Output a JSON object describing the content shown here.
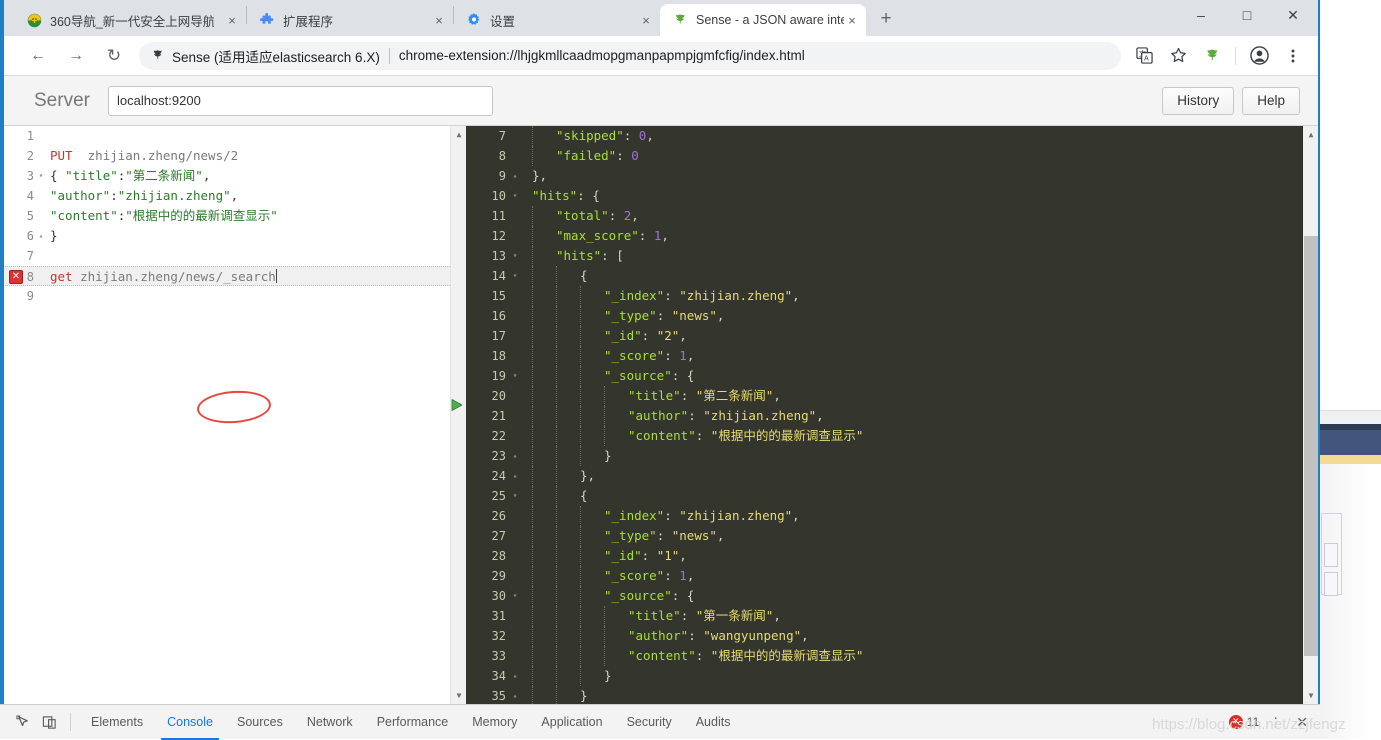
{
  "browser": {
    "tabs": [
      {
        "title": "360导航_新一代安全上网导航",
        "favicon": "shield-360-icon",
        "active": false,
        "close_label": "×"
      },
      {
        "title": "扩展程序",
        "favicon": "puzzle-icon",
        "active": false,
        "close_label": "×"
      },
      {
        "title": "设置",
        "favicon": "gear-icon",
        "active": false,
        "close_label": "×"
      },
      {
        "title": "Sense - a JSON aware interface",
        "favicon": "sense-leaf-icon",
        "active": true,
        "close_label": "×"
      }
    ],
    "new_tab_label": "+",
    "window_controls": {
      "minimize": "–",
      "maximize": "□",
      "close": "✕"
    },
    "nav": {
      "back": "←",
      "forward": "→",
      "reload": "↻",
      "omnibox_extension_name": "Sense (适用适应elasticsearch 6.X)",
      "omnibox_url": "chrome-extension://lhjgkmllcaadmopgmanpapmpjgmfcfig/index.html",
      "translate_icon": "translate-icon",
      "bookmark_icon": "star-icon",
      "extension_icon": "sense-leaf-icon",
      "profile_icon": "profile-avatar-icon",
      "menu_icon": "kebab-menu-icon"
    }
  },
  "sense": {
    "server_label": "Server",
    "server_value": "localhost:9200",
    "server_placeholder": "localhost:9200",
    "history_label": "History",
    "help_label": "Help"
  },
  "request_editor": {
    "error_marker_line": 8,
    "error_marker_glyph": "✕",
    "play_icon": "run-request-icon",
    "wrench_icon": "settings-wrench-icon",
    "annotation": "red-ellipse-highlight",
    "lines": [
      {
        "n": "1",
        "fold": "",
        "tokens": []
      },
      {
        "n": "2",
        "fold": "",
        "tokens": [
          {
            "c": "tk-method",
            "t": "PUT"
          },
          {
            "c": "tk-plain",
            "t": "  "
          },
          {
            "c": "tk-url",
            "t": "zhijian.zheng/news/2"
          }
        ]
      },
      {
        "n": "3",
        "fold": "▾",
        "tokens": [
          {
            "c": "tk-punc",
            "t": "{ "
          },
          {
            "c": "tk-key",
            "t": "\"title\""
          },
          {
            "c": "tk-punc",
            "t": ":"
          },
          {
            "c": "tk-str",
            "t": "\"第二条新闻\""
          },
          {
            "c": "tk-punc",
            "t": ","
          }
        ]
      },
      {
        "n": "4",
        "fold": "",
        "tokens": [
          {
            "c": "tk-key",
            "t": "\"author\""
          },
          {
            "c": "tk-punc",
            "t": ":"
          },
          {
            "c": "tk-str",
            "t": "\"zhijian.zheng\""
          },
          {
            "c": "tk-punc",
            "t": ","
          }
        ]
      },
      {
        "n": "5",
        "fold": "",
        "tokens": [
          {
            "c": "tk-key",
            "t": "\"content\""
          },
          {
            "c": "tk-punc",
            "t": ":"
          },
          {
            "c": "tk-str",
            "t": "\"根据中的的最新调查显示\""
          }
        ]
      },
      {
        "n": "6",
        "fold": "▴",
        "tokens": [
          {
            "c": "tk-punc",
            "t": "}"
          }
        ]
      },
      {
        "n": "7",
        "fold": "",
        "tokens": []
      },
      {
        "n": "8",
        "fold": "",
        "active": true,
        "tokens": [
          {
            "c": "tk-method",
            "t": "get"
          },
          {
            "c": "tk-plain",
            "t": " "
          },
          {
            "c": "tk-url",
            "t": "zhijian.zheng/news/_search"
          }
        ]
      },
      {
        "n": "9",
        "fold": "",
        "tokens": []
      }
    ]
  },
  "response_viewer": {
    "lines": [
      {
        "n": "7",
        "fold": "",
        "ind": 2,
        "tokens": [
          {
            "c": "rk",
            "t": "\"skipped\""
          },
          {
            "c": "rp",
            "t": ": "
          },
          {
            "c": "rn",
            "t": "0"
          },
          {
            "c": "rp",
            "t": ","
          }
        ]
      },
      {
        "n": "8",
        "fold": "",
        "ind": 2,
        "tokens": [
          {
            "c": "rk",
            "t": "\"failed\""
          },
          {
            "c": "rp",
            "t": ": "
          },
          {
            "c": "rn",
            "t": "0"
          }
        ]
      },
      {
        "n": "9",
        "fold": "▴",
        "ind": 1,
        "tokens": [
          {
            "c": "rp",
            "t": "},"
          }
        ]
      },
      {
        "n": "10",
        "fold": "▾",
        "ind": 1,
        "tokens": [
          {
            "c": "rk",
            "t": "\"hits\""
          },
          {
            "c": "rp",
            "t": ": {"
          }
        ]
      },
      {
        "n": "11",
        "fold": "",
        "ind": 2,
        "tokens": [
          {
            "c": "rk",
            "t": "\"total\""
          },
          {
            "c": "rp",
            "t": ": "
          },
          {
            "c": "rn",
            "t": "2"
          },
          {
            "c": "rp",
            "t": ","
          }
        ]
      },
      {
        "n": "12",
        "fold": "",
        "ind": 2,
        "tokens": [
          {
            "c": "rk",
            "t": "\"max_score\""
          },
          {
            "c": "rp",
            "t": ": "
          },
          {
            "c": "rn",
            "t": "1"
          },
          {
            "c": "rp",
            "t": ","
          }
        ]
      },
      {
        "n": "13",
        "fold": "▾",
        "ind": 2,
        "tokens": [
          {
            "c": "rk",
            "t": "\"hits\""
          },
          {
            "c": "rp",
            "t": ": ["
          }
        ]
      },
      {
        "n": "14",
        "fold": "▾",
        "ind": 3,
        "tokens": [
          {
            "c": "rp",
            "t": "{"
          }
        ]
      },
      {
        "n": "15",
        "fold": "",
        "ind": 4,
        "tokens": [
          {
            "c": "rk",
            "t": "\"_index\""
          },
          {
            "c": "rp",
            "t": ": "
          },
          {
            "c": "rs",
            "t": "\"zhijian.zheng\""
          },
          {
            "c": "rp",
            "t": ","
          }
        ]
      },
      {
        "n": "16",
        "fold": "",
        "ind": 4,
        "tokens": [
          {
            "c": "rk",
            "t": "\"_type\""
          },
          {
            "c": "rp",
            "t": ": "
          },
          {
            "c": "rs",
            "t": "\"news\""
          },
          {
            "c": "rp",
            "t": ","
          }
        ]
      },
      {
        "n": "17",
        "fold": "",
        "ind": 4,
        "tokens": [
          {
            "c": "rk",
            "t": "\"_id\""
          },
          {
            "c": "rp",
            "t": ": "
          },
          {
            "c": "rs",
            "t": "\"2\""
          },
          {
            "c": "rp",
            "t": ","
          }
        ]
      },
      {
        "n": "18",
        "fold": "",
        "ind": 4,
        "tokens": [
          {
            "c": "rk",
            "t": "\"_score\""
          },
          {
            "c": "rp",
            "t": ": "
          },
          {
            "c": "rn",
            "t": "1"
          },
          {
            "c": "rp",
            "t": ","
          }
        ]
      },
      {
        "n": "19",
        "fold": "▾",
        "ind": 4,
        "tokens": [
          {
            "c": "rk",
            "t": "\"_source\""
          },
          {
            "c": "rp",
            "t": ": {"
          }
        ]
      },
      {
        "n": "20",
        "fold": "",
        "ind": 5,
        "tokens": [
          {
            "c": "rk",
            "t": "\"title\""
          },
          {
            "c": "rp",
            "t": ": "
          },
          {
            "c": "rs",
            "t": "\"第二条新闻\""
          },
          {
            "c": "rp",
            "t": ","
          }
        ]
      },
      {
        "n": "21",
        "fold": "",
        "ind": 5,
        "tokens": [
          {
            "c": "rk",
            "t": "\"author\""
          },
          {
            "c": "rp",
            "t": ": "
          },
          {
            "c": "rs",
            "t": "\"zhijian.zheng\""
          },
          {
            "c": "rp",
            "t": ","
          }
        ]
      },
      {
        "n": "22",
        "fold": "",
        "ind": 5,
        "tokens": [
          {
            "c": "rk",
            "t": "\"content\""
          },
          {
            "c": "rp",
            "t": ": "
          },
          {
            "c": "rs",
            "t": "\"根据中的的最新调查显示\""
          }
        ]
      },
      {
        "n": "23",
        "fold": "▴",
        "ind": 4,
        "tokens": [
          {
            "c": "rp",
            "t": "}"
          }
        ]
      },
      {
        "n": "24",
        "fold": "▴",
        "ind": 3,
        "tokens": [
          {
            "c": "rp",
            "t": "},"
          }
        ]
      },
      {
        "n": "25",
        "fold": "▾",
        "ind": 3,
        "tokens": [
          {
            "c": "rp",
            "t": "{"
          }
        ]
      },
      {
        "n": "26",
        "fold": "",
        "ind": 4,
        "tokens": [
          {
            "c": "rk",
            "t": "\"_index\""
          },
          {
            "c": "rp",
            "t": ": "
          },
          {
            "c": "rs",
            "t": "\"zhijian.zheng\""
          },
          {
            "c": "rp",
            "t": ","
          }
        ]
      },
      {
        "n": "27",
        "fold": "",
        "ind": 4,
        "tokens": [
          {
            "c": "rk",
            "t": "\"_type\""
          },
          {
            "c": "rp",
            "t": ": "
          },
          {
            "c": "rs",
            "t": "\"news\""
          },
          {
            "c": "rp",
            "t": ","
          }
        ]
      },
      {
        "n": "28",
        "fold": "",
        "ind": 4,
        "tokens": [
          {
            "c": "rk",
            "t": "\"_id\""
          },
          {
            "c": "rp",
            "t": ": "
          },
          {
            "c": "rs",
            "t": "\"1\""
          },
          {
            "c": "rp",
            "t": ","
          }
        ]
      },
      {
        "n": "29",
        "fold": "",
        "ind": 4,
        "tokens": [
          {
            "c": "rk",
            "t": "\"_score\""
          },
          {
            "c": "rp",
            "t": ": "
          },
          {
            "c": "rn",
            "t": "1"
          },
          {
            "c": "rp",
            "t": ","
          }
        ]
      },
      {
        "n": "30",
        "fold": "▾",
        "ind": 4,
        "tokens": [
          {
            "c": "rk",
            "t": "\"_source\""
          },
          {
            "c": "rp",
            "t": ": {"
          }
        ]
      },
      {
        "n": "31",
        "fold": "",
        "ind": 5,
        "tokens": [
          {
            "c": "rk",
            "t": "\"title\""
          },
          {
            "c": "rp",
            "t": ": "
          },
          {
            "c": "rs",
            "t": "\"第一条新闻\""
          },
          {
            "c": "rp",
            "t": ","
          }
        ]
      },
      {
        "n": "32",
        "fold": "",
        "ind": 5,
        "tokens": [
          {
            "c": "rk",
            "t": "\"author\""
          },
          {
            "c": "rp",
            "t": ": "
          },
          {
            "c": "rs",
            "t": "\"wangyunpeng\""
          },
          {
            "c": "rp",
            "t": ","
          }
        ]
      },
      {
        "n": "33",
        "fold": "",
        "ind": 5,
        "tokens": [
          {
            "c": "rk",
            "t": "\"content\""
          },
          {
            "c": "rp",
            "t": ": "
          },
          {
            "c": "rs",
            "t": "\"根据中的的最新调查显示\""
          }
        ]
      },
      {
        "n": "34",
        "fold": "▴",
        "ind": 4,
        "tokens": [
          {
            "c": "rp",
            "t": "}"
          }
        ]
      },
      {
        "n": "35",
        "fold": "▴",
        "ind": 3,
        "tokens": [
          {
            "c": "rp",
            "t": "}"
          }
        ]
      }
    ]
  },
  "devtools": {
    "inspect_icon": "inspect-element-icon",
    "device_icon": "device-toolbar-icon",
    "tabs": [
      {
        "label": "Elements",
        "active": false
      },
      {
        "label": "Console",
        "active": true
      },
      {
        "label": "Sources",
        "active": false
      },
      {
        "label": "Network",
        "active": false
      },
      {
        "label": "Performance",
        "active": false
      },
      {
        "label": "Memory",
        "active": false
      },
      {
        "label": "Application",
        "active": false
      },
      {
        "label": "Security",
        "active": false
      },
      {
        "label": "Audits",
        "active": false
      }
    ],
    "error_count": "11",
    "error_glyph": "✕",
    "kebab": "⋮",
    "close": "✕"
  },
  "watermark": {
    "text": "https://blog.csdn.net/zzjfengz"
  },
  "colors": {
    "accent_blue": "#1a73e8",
    "tabstrip_bg": "#dee1e6",
    "editor_dark_bg": "#34352c",
    "json_key": "#a6e22e",
    "json_string": "#e6db74",
    "json_number": "#9d72d8",
    "error_red": "#d93025",
    "annotation_red": "#e8473f",
    "window_edge_blue": "#1f7fc4"
  }
}
